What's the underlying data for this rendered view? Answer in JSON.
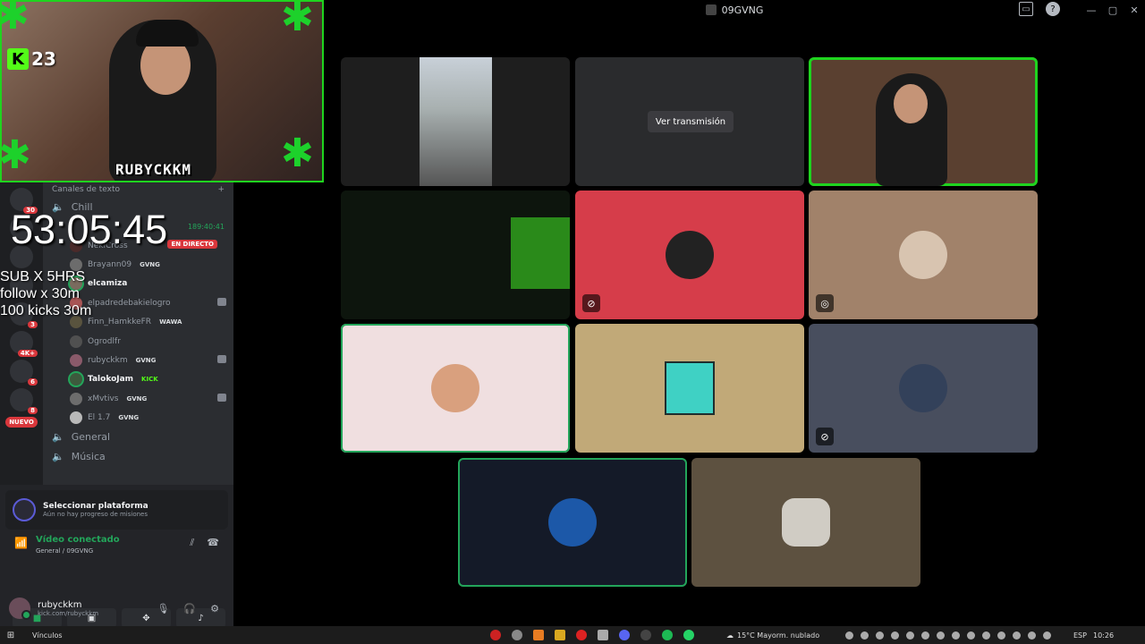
{
  "window": {
    "title": "09GVNG"
  },
  "stream_overlay": {
    "kick_count": "23",
    "handle": "RUBYCKKM",
    "timer": "53:05:45",
    "promos": [
      "SUB X 5HRS",
      "follow x 30m",
      "100 kicks 30m"
    ]
  },
  "rail": {
    "badges": [
      "30",
      "3",
      "4K+",
      "6",
      "8"
    ],
    "new_label": "NUEVO"
  },
  "channels": {
    "category": "Canales de texto",
    "chill": "Chill",
    "timestamp": "189:40:41",
    "live_label": "EN DIRECTO",
    "members": [
      {
        "name": "NekiCross",
        "tag": ""
      },
      {
        "name": "Brayann09",
        "tag": "GVNG"
      },
      {
        "name": "elcamiza",
        "tag": ""
      },
      {
        "name": "elpadredebakielogro",
        "tag": ""
      },
      {
        "name": "Finn_HamkkeFR",
        "tag": "WAWA"
      },
      {
        "name": "Ogrodlfr",
        "tag": ""
      },
      {
        "name": "rubyckkm",
        "tag": "GVNG"
      },
      {
        "name": "TalokoJam",
        "tag": "KICK"
      },
      {
        "name": "xMvtivs",
        "tag": "GVNG"
      },
      {
        "name": "El 1.7",
        "tag": "GVNG"
      }
    ],
    "general": "General",
    "music": "Música"
  },
  "user_panel": {
    "platform_title": "Seleccionar plataforma",
    "platform_sub": "Aún no hay progreso de misiones",
    "voice_title": "Vídeo conectado",
    "voice_sub": "General / 09GVNG",
    "username": "rubyckkm",
    "status": "kick.com/rubyckkm"
  },
  "grid": {
    "watch_stream": "Ver transmisión",
    "colors": {
      "red": "#d63d4a",
      "tan": "#a1826a",
      "pink": "#f0dfe0",
      "gold": "#c1a978",
      "slate": "#484e5e",
      "navy": "#141a28",
      "brown": "#5d5140"
    }
  },
  "taskbar": {
    "links": "Vínculos",
    "weather": "15°C  Mayorm. nublado",
    "lang": "ESP",
    "time": "10:26"
  }
}
